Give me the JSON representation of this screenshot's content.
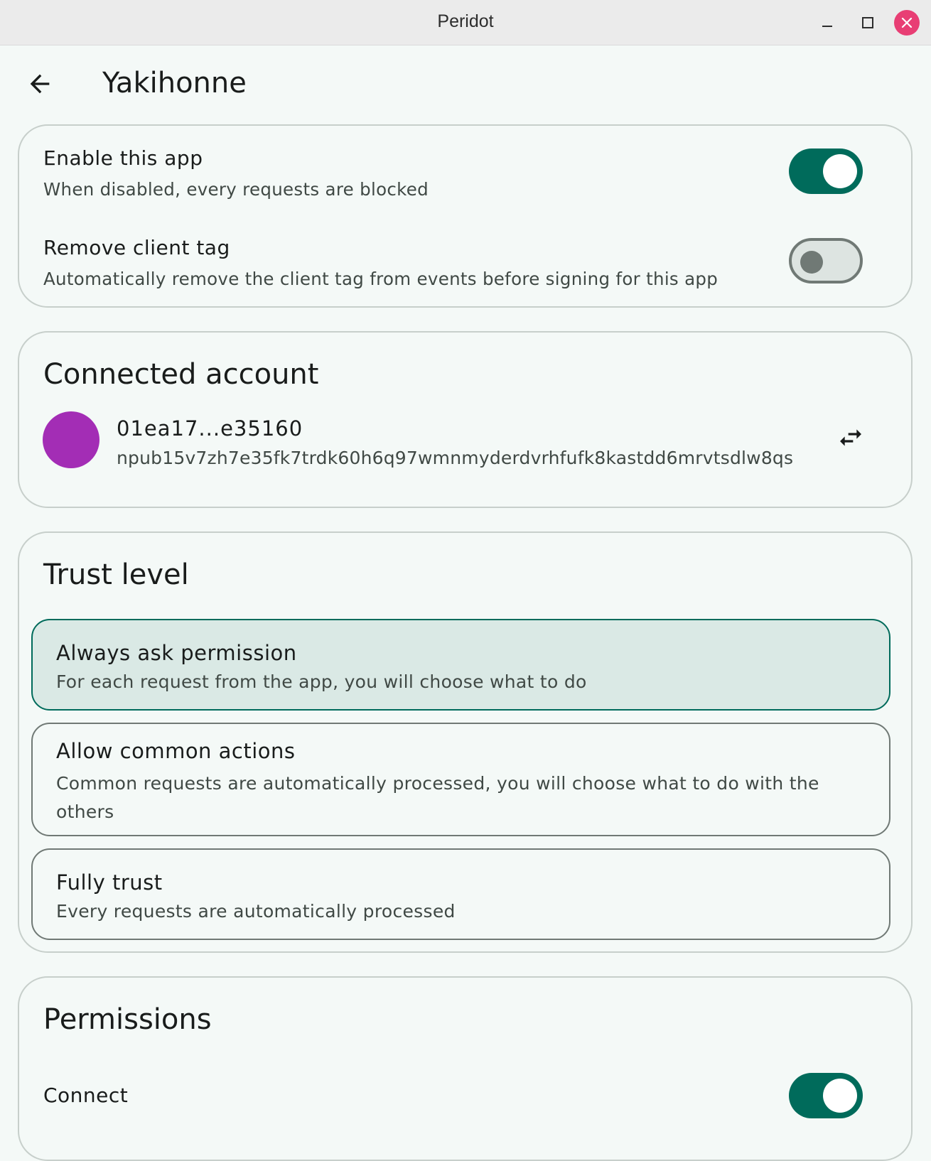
{
  "window": {
    "title": "Peridot"
  },
  "app_bar": {
    "title": "Yakihonne"
  },
  "app_settings": {
    "enable_app": {
      "title": "Enable this app",
      "description": "When disabled, every requests are blocked",
      "enabled": true
    },
    "remove_client_tag": {
      "title": "Remove client tag",
      "description": "Automatically remove the client tag from events before signing for this app",
      "enabled": false
    }
  },
  "connected_account": {
    "heading": "Connected account",
    "short_id": "01ea17...e35160",
    "npub": "npub15v7zh7e35fk7trdk60h6q97wmnmyderdvrhfufk8kastdd6mrvtsdlw8qs",
    "avatar_color": "#a32db5",
    "switch_icon": "swap-horiz-icon"
  },
  "trust_level": {
    "heading": "Trust level",
    "options": [
      {
        "title": "Always ask permission",
        "description": "For each request from the app, you will choose what to do",
        "selected": true
      },
      {
        "title": "Allow common actions",
        "description": "Common requests are automatically processed, you will choose what to do with the others",
        "selected": false
      },
      {
        "title": "Fully trust",
        "description": "Every requests are automatically processed",
        "selected": false
      }
    ]
  },
  "permissions": {
    "heading": "Permissions",
    "items": [
      {
        "title": "Connect",
        "enabled": true
      }
    ]
  },
  "colors": {
    "accent": "#006b5b",
    "background": "#f4f9f7",
    "selected_option_bg": "#dae9e5",
    "close_button": "#e83e74"
  }
}
